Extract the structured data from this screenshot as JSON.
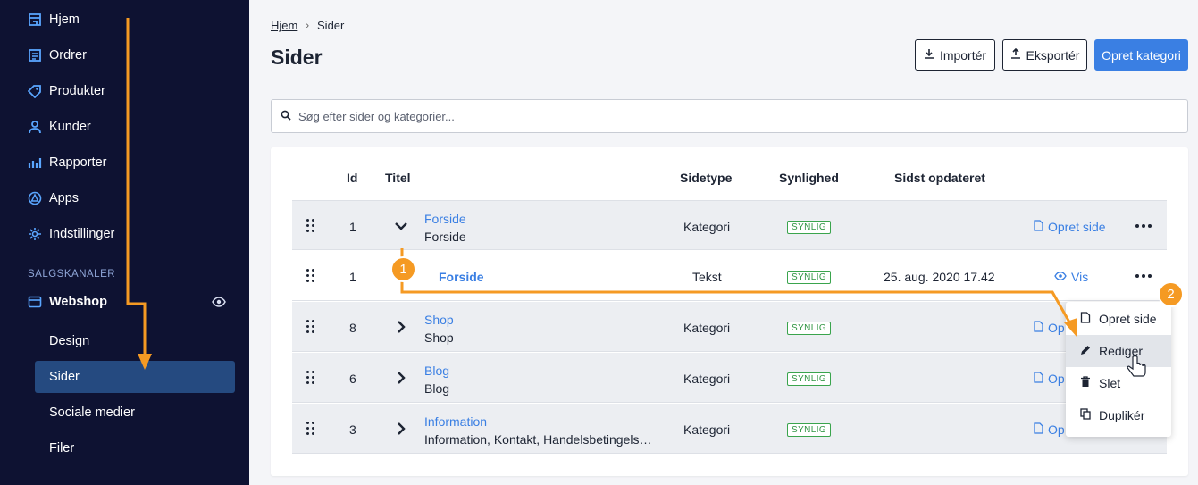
{
  "sidebar": {
    "items": [
      {
        "label": "Hjem",
        "icon": "store-icon"
      },
      {
        "label": "Ordrer",
        "icon": "orders-icon"
      },
      {
        "label": "Produkter",
        "icon": "tag-icon"
      },
      {
        "label": "Kunder",
        "icon": "user-icon"
      },
      {
        "label": "Rapporter",
        "icon": "chart-icon"
      },
      {
        "label": "Apps",
        "icon": "apps-icon"
      },
      {
        "label": "Indstillinger",
        "icon": "gear-icon"
      }
    ],
    "section_label": "SALGSKANALER",
    "channel": {
      "label": "Webshop",
      "icon": "webshop-icon"
    },
    "sub_items": [
      "Design",
      "Sider",
      "Sociale medier",
      "Filer"
    ],
    "active_sub": "Sider"
  },
  "breadcrumb": {
    "home": "Hjem",
    "current": "Sider"
  },
  "page_title": "Sider",
  "buttons": {
    "import": "Importér",
    "export": "Eksportér",
    "create_category": "Opret kategori"
  },
  "search": {
    "placeholder": "Søg efter sider og kategorier..."
  },
  "table": {
    "headers": {
      "id": "Id",
      "title": "Titel",
      "type": "Sidetype",
      "visibility": "Synlighed",
      "updated": "Sidst opdateret"
    },
    "rows": [
      {
        "id": "1",
        "title": "Forside",
        "subtitle": "Forside",
        "type": "Kategori",
        "visibility": "SYNLIG",
        "updated": "",
        "action": "Opret side",
        "expanded": true
      },
      {
        "id": "1",
        "title": "Forside",
        "subtitle": "",
        "type": "Tekst",
        "visibility": "SYNLIG",
        "updated": "25. aug. 2020 17.42",
        "action": "Vis"
      },
      {
        "id": "8",
        "title": "Shop",
        "subtitle": "Shop",
        "type": "Kategori",
        "visibility": "SYNLIG",
        "updated": "",
        "action": "Op"
      },
      {
        "id": "6",
        "title": "Blog",
        "subtitle": "Blog",
        "type": "Kategori",
        "visibility": "SYNLIG",
        "updated": "",
        "action": "Op"
      },
      {
        "id": "3",
        "title": "Information",
        "subtitle": "Information, Kontakt, Handelsbetingels…",
        "type": "Kategori",
        "visibility": "SYNLIG",
        "updated": "",
        "action": "Op"
      }
    ]
  },
  "dropdown": {
    "items": [
      "Opret side",
      "Rediger",
      "Slet",
      "Duplikér"
    ],
    "highlighted": "Rediger"
  },
  "annotations": {
    "step1": "1",
    "step2": "2",
    "color": "#f59a23"
  },
  "colors": {
    "sidebar_bg": "#0e1232",
    "accent": "#3a7fe3",
    "active_bg": "#254a80",
    "badge": "#2f9442"
  }
}
